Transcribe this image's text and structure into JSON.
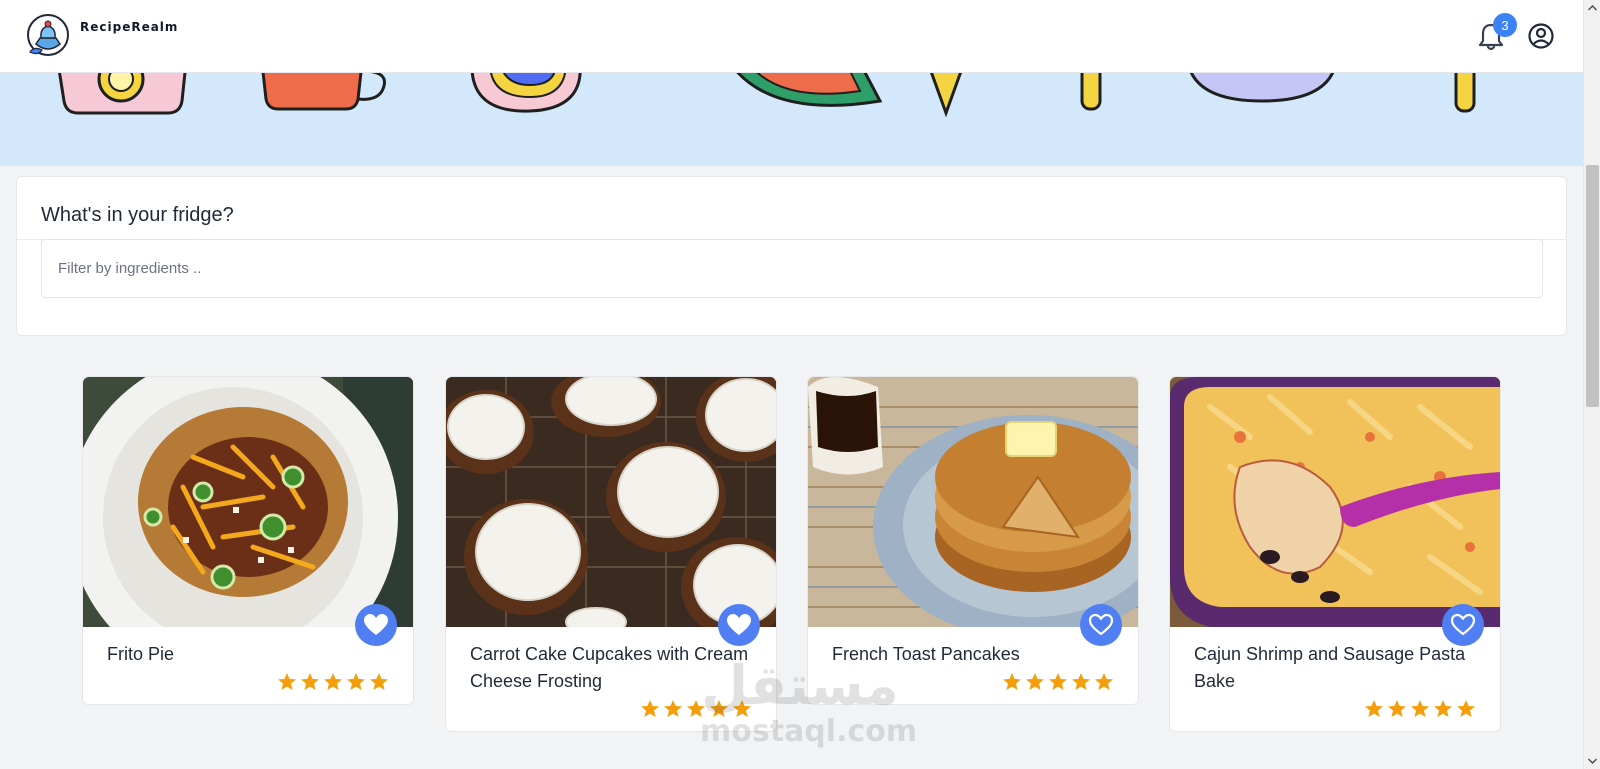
{
  "app": {
    "name": "RecipeRealm",
    "brand_color": "#3b82f6"
  },
  "header": {
    "notification_count": "3",
    "notification_icon": "bell-icon",
    "user_icon": "user-circle-icon"
  },
  "filter": {
    "title": "What's in your fridge?",
    "placeholder": "Filter by ingredients .."
  },
  "recipes": [
    {
      "title": "Frito Pie",
      "rating": 5,
      "favorited": true
    },
    {
      "title": "Carrot Cake Cupcakes with Cream Cheese Frosting",
      "rating": 5,
      "favorited": true
    },
    {
      "title": "French Toast Pancakes",
      "rating": 5,
      "favorited": false
    },
    {
      "title": "Cajun Shrimp and Sausage Pasta Bake",
      "rating": 5,
      "favorited": false
    }
  ],
  "watermark": {
    "arabic": "مستقل",
    "latin": "mostaql.com"
  },
  "colors": {
    "hero_bg": "#d4e8fb",
    "star": "#f59e0b",
    "favorite_button": "#4f7ff2"
  }
}
